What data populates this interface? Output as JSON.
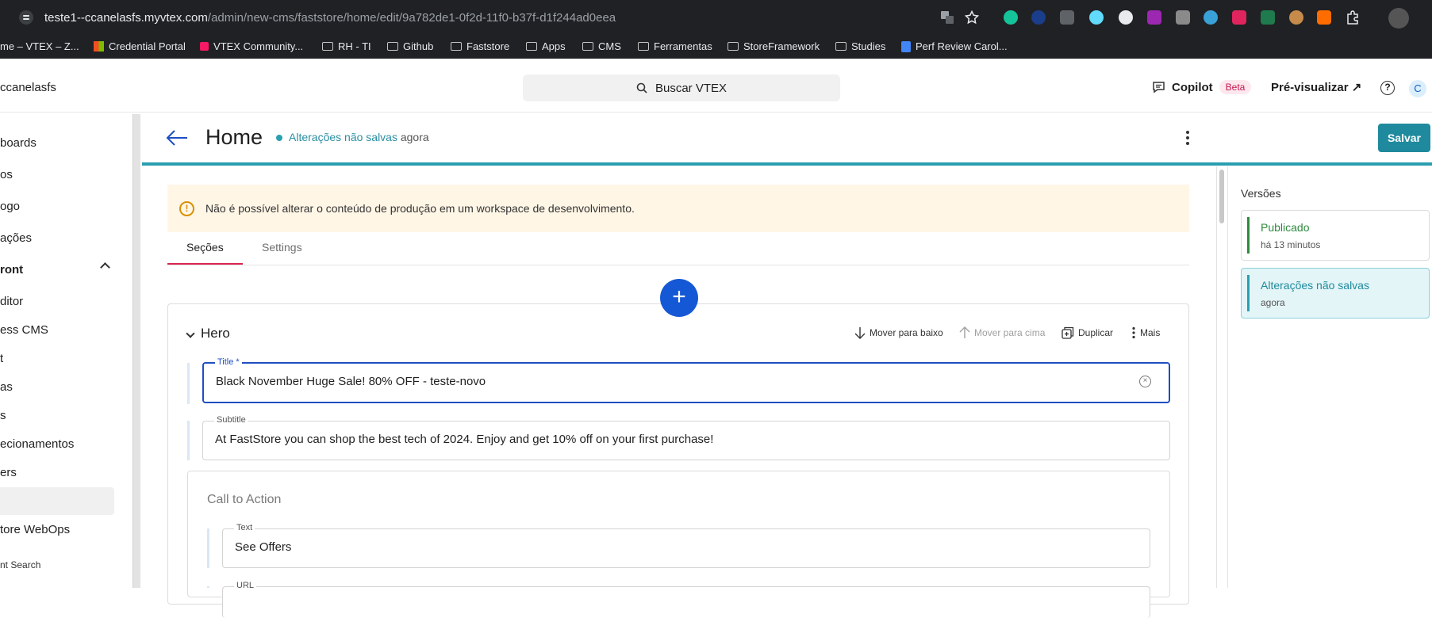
{
  "browser": {
    "url_host": "teste1--ccanelasfs.myvtex.com",
    "url_path": "/admin/new-cms/faststore/home/edit/9a782de1-0f2d-11f0-b37f-d1f244ad0eea",
    "bookmarks": [
      {
        "label": "me – VTEX – Z...",
        "icon": "tab-icon"
      },
      {
        "label": "Credential Portal",
        "icon": "microsoft-icon"
      },
      {
        "label": "VTEX Community...",
        "icon": "vtex-icon"
      },
      {
        "label": "RH - TI",
        "icon": "folder-icon"
      },
      {
        "label": "Github",
        "icon": "folder-icon"
      },
      {
        "label": "Faststore",
        "icon": "folder-icon"
      },
      {
        "label": "Apps",
        "icon": "folder-icon"
      },
      {
        "label": "CMS",
        "icon": "folder-icon"
      },
      {
        "label": "Ferramentas",
        "icon": "folder-icon"
      },
      {
        "label": "StoreFramework",
        "icon": "folder-icon"
      },
      {
        "label": "Studies",
        "icon": "folder-icon"
      },
      {
        "label": "Perf Review Carol...",
        "icon": "doc-icon"
      }
    ]
  },
  "header": {
    "account": "ccanelasfs",
    "search_label": "Buscar VTEX",
    "copilot_label": "Copilot",
    "copilot_badge": "Beta",
    "preview_label": "Pré-visualizar ↗",
    "help_glyph": "?",
    "avatar_initial": "C"
  },
  "sidebar": {
    "items": [
      {
        "label": "boards"
      },
      {
        "label": "os"
      },
      {
        "label": "ogo"
      },
      {
        "label": "ações"
      },
      {
        "label": "ront"
      },
      {
        "label": "ditor"
      },
      {
        "label": "ess CMS"
      },
      {
        "label": "t"
      },
      {
        "label": "as"
      },
      {
        "label": "s"
      },
      {
        "label": "ecionamentos"
      },
      {
        "label": "ers"
      },
      {
        "label": ""
      },
      {
        "label": "tore WebOps"
      },
      {
        "label": "nt Search"
      }
    ]
  },
  "editor": {
    "page_title": "Home",
    "status_label": "Alterações não salvas",
    "status_time": "agora",
    "save_label": "Salvar",
    "warning": "Não é possível alterar o conteúdo de produção em um workspace de desenvolvimento.",
    "tabs": [
      {
        "label": "Seções"
      },
      {
        "label": "Settings"
      }
    ],
    "add_glyph": "+"
  },
  "hero": {
    "title": "Hero",
    "actions": {
      "move_down": "Mover para baixo",
      "move_up": "Mover para cima",
      "duplicate": "Duplicar",
      "more": "Mais"
    },
    "fields": {
      "title_label": "Title *",
      "title_value": "Black November Huge Sale! 80% OFF - teste-novo",
      "subtitle_label": "Subtitle",
      "subtitle_value": "At FastStore you can shop the best tech of 2024. Enjoy and get 10% off on your first purchase!"
    },
    "cta": {
      "title": "Call to Action",
      "text_label": "Text",
      "text_value": "See Offers",
      "url_label": "URL"
    }
  },
  "versions": {
    "title": "Versões",
    "items": [
      {
        "name": "Publicado",
        "time": "há 13 minutos",
        "color": "#2e8b3e"
      },
      {
        "name": "Alterações não salvas",
        "time": "agora",
        "color": "#2a9fb0"
      }
    ]
  }
}
